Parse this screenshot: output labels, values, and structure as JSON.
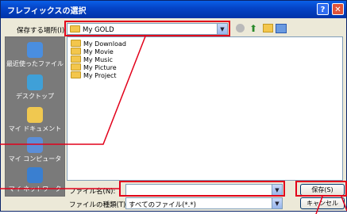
{
  "window": {
    "title": "フレフィックスの選択"
  },
  "titlebar_buttons": {
    "help": "?",
    "close": "✕"
  },
  "save_in": {
    "label": "保存する場所(I):",
    "value": "My GOLD"
  },
  "places": [
    "最近使ったファイル",
    "デスクトップ",
    "マイ ドキュメント",
    "マイ コンピュータ",
    "マイ ネットワーク"
  ],
  "folders": [
    "My Download",
    "My Movie",
    "My Music",
    "My Picture",
    "My Project"
  ],
  "filename": {
    "label": "ファイル名(N):",
    "value": ""
  },
  "filetype": {
    "label": "ファイルの種類(T):",
    "value": "すべてのファイル(*.*)"
  },
  "buttons": {
    "save": "保存(S)",
    "cancel": "キャンセル"
  },
  "colors": {
    "accent_red": "#e2001a",
    "title_blue": "#0545c8"
  }
}
